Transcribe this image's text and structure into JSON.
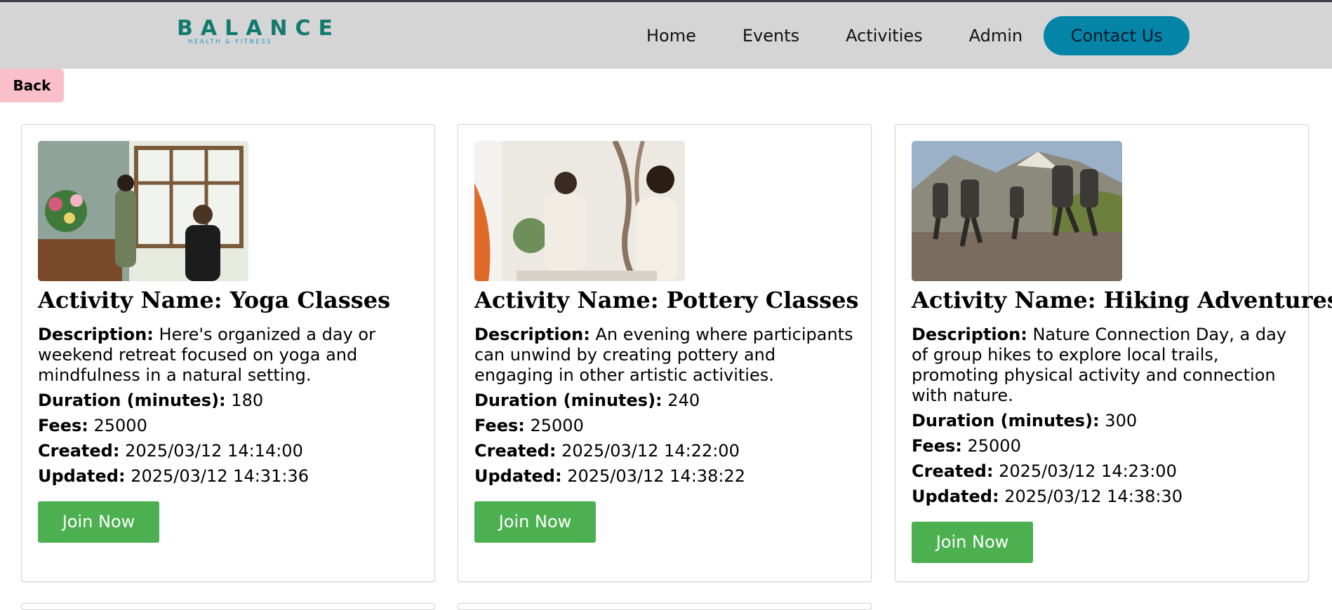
{
  "header": {
    "logo_main": "BALANCE",
    "logo_sub": "HEALTH & FITNESS",
    "nav": [
      "Home",
      "Events",
      "Activities",
      "Admin"
    ],
    "contact_label": "Contact Us"
  },
  "back_label": "Back",
  "labels": {
    "name_prefix": "Activity Name: ",
    "description": "Description:",
    "duration": "Duration (minutes):",
    "fees": "Fees:",
    "created": "Created:",
    "updated": "Updated:",
    "join": "Join Now"
  },
  "activities": [
    {
      "name": "Yoga Classes",
      "description": "Here's organized a day or weekend retreat focused on yoga and mindfulness in a natural setting.",
      "duration": "180",
      "fees": "25000",
      "created": "2025/03/12 14:14:00",
      "updated": "2025/03/12 14:31:36",
      "image": "flower-shop-photo"
    },
    {
      "name": "Pottery Classes",
      "description": "An evening where participants can unwind by creating pottery and engaging in other artistic activities.",
      "duration": "240",
      "fees": "25000",
      "created": "2025/03/12 14:22:00",
      "updated": "2025/03/12 14:38:22",
      "image": "pottery-workshop-photo"
    },
    {
      "name": "Hiking Adventures",
      "description": "Nature Connection Day, a day of group hikes to explore local trails, promoting physical activity and connection with nature.",
      "duration": "300",
      "fees": "25000",
      "created": "2025/03/12 14:23:00",
      "updated": "2025/03/12 14:38:30",
      "image": "hikers-photo"
    }
  ],
  "colors": {
    "header_bg": "#d5d5d5",
    "logo": "#137a6e",
    "contact_bg": "#0485a8",
    "back_bg": "#f9c0cb",
    "join_bg": "#4caf50"
  }
}
